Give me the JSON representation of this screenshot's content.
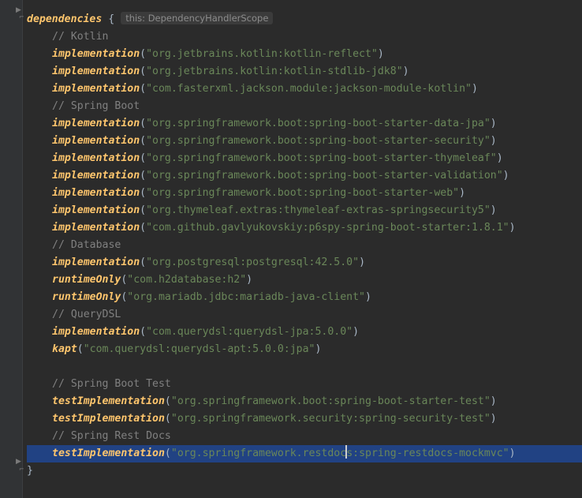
{
  "editor": {
    "inlay_hint": "this: DependencyHandlerScope",
    "lines": [
      {
        "type": "open",
        "keyword": "dependencies",
        "brace": "{"
      },
      {
        "type": "comment",
        "text": "// Kotlin"
      },
      {
        "type": "dep",
        "config": "implementation",
        "value": "\"org.jetbrains.kotlin:kotlin-reflect\""
      },
      {
        "type": "dep",
        "config": "implementation",
        "value": "\"org.jetbrains.kotlin:kotlin-stdlib-jdk8\""
      },
      {
        "type": "dep",
        "config": "implementation",
        "value": "\"com.fasterxml.jackson.module:jackson-module-kotlin\""
      },
      {
        "type": "comment",
        "text": "// Spring Boot"
      },
      {
        "type": "dep",
        "config": "implementation",
        "value": "\"org.springframework.boot:spring-boot-starter-data-jpa\""
      },
      {
        "type": "dep",
        "config": "implementation",
        "value": "\"org.springframework.boot:spring-boot-starter-security\""
      },
      {
        "type": "dep",
        "config": "implementation",
        "value": "\"org.springframework.boot:spring-boot-starter-thymeleaf\""
      },
      {
        "type": "dep",
        "config": "implementation",
        "value": "\"org.springframework.boot:spring-boot-starter-validation\""
      },
      {
        "type": "dep",
        "config": "implementation",
        "value": "\"org.springframework.boot:spring-boot-starter-web\""
      },
      {
        "type": "dep",
        "config": "implementation",
        "value": "\"org.thymeleaf.extras:thymeleaf-extras-springsecurity5\""
      },
      {
        "type": "dep",
        "config": "implementation",
        "value": "\"com.github.gavlyukovskiy:p6spy-spring-boot-starter:1.8.1\""
      },
      {
        "type": "comment",
        "text": "// Database"
      },
      {
        "type": "dep",
        "config": "implementation",
        "value": "\"org.postgresql:postgresql:42.5.0\""
      },
      {
        "type": "dep",
        "config": "runtimeOnly",
        "value": "\"com.h2database:h2\""
      },
      {
        "type": "dep",
        "config": "runtimeOnly",
        "value": "\"org.mariadb.jdbc:mariadb-java-client\""
      },
      {
        "type": "comment",
        "text": "// QueryDSL"
      },
      {
        "type": "dep",
        "config": "implementation",
        "value": "\"com.querydsl:querydsl-jpa:5.0.0\""
      },
      {
        "type": "dep",
        "config": "kapt",
        "value": "\"com.querydsl:querydsl-apt:5.0.0:jpa\""
      },
      {
        "type": "blank"
      },
      {
        "type": "comment",
        "text": "// Spring Boot Test"
      },
      {
        "type": "dep",
        "config": "testImplementation",
        "value": "\"org.springframework.boot:spring-boot-starter-test\""
      },
      {
        "type": "dep",
        "config": "testImplementation",
        "value": "\"org.springframework.security:spring-security-test\""
      },
      {
        "type": "comment",
        "text": "// Spring Rest Docs"
      },
      {
        "type": "dep",
        "config": "testImplementation",
        "value": "\"org.springframework.restdocs:spring-restdocs-mockmvc\"",
        "highlighted": true,
        "caret_after": 27
      },
      {
        "type": "close",
        "brace": "}"
      }
    ]
  },
  "colors": {
    "background": "#2b2b2b",
    "string": "#6a8759",
    "config": "#ffc66d",
    "comment": "#808080",
    "current_line": "#214283"
  },
  "icons": [
    "fold-arrow-icon",
    "fold-end-icon"
  ]
}
